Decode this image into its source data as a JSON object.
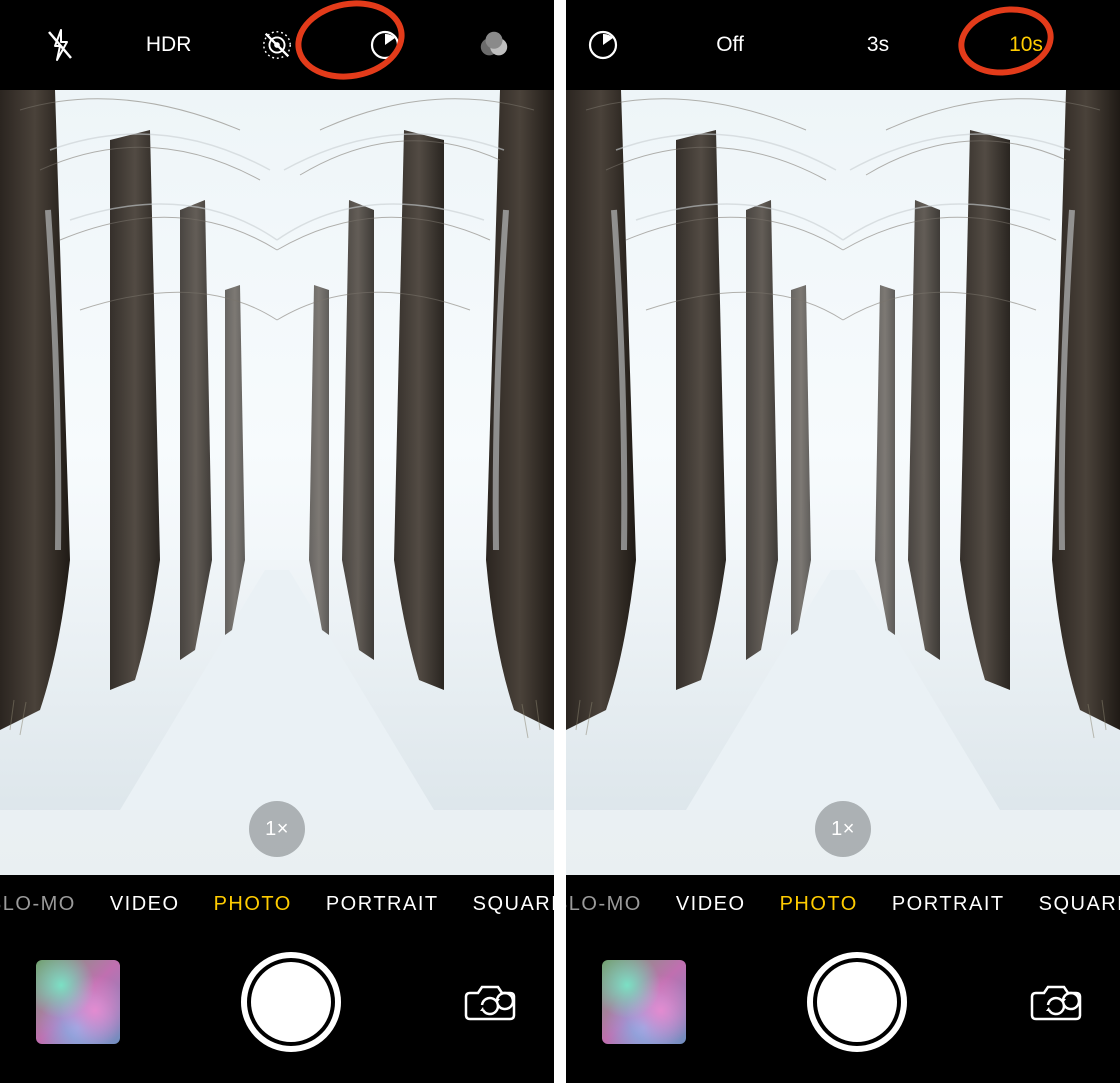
{
  "left": {
    "topbar": {
      "flash": "off",
      "hdr_label": "HDR",
      "live_photos": "off",
      "timer": "off",
      "filters": "off"
    },
    "zoom_label": "1×",
    "modes": [
      "SLO-MO",
      "VIDEO",
      "PHOTO",
      "PORTRAIT",
      "SQUARE"
    ],
    "selected_mode_index": 2,
    "annotation_target": "timer"
  },
  "right": {
    "topbar": {
      "timer_icon": "on",
      "timer_options": [
        "Off",
        "3s",
        "10s"
      ],
      "selected_timer_index": 2
    },
    "zoom_label": "1×",
    "modes": [
      "SLO-MO",
      "VIDEO",
      "PHOTO",
      "PORTRAIT",
      "SQUARE"
    ],
    "selected_mode_index": 2,
    "annotation_target": "10s"
  },
  "colors": {
    "accent": "#ffcc00",
    "annotation": "#e33b1a"
  }
}
